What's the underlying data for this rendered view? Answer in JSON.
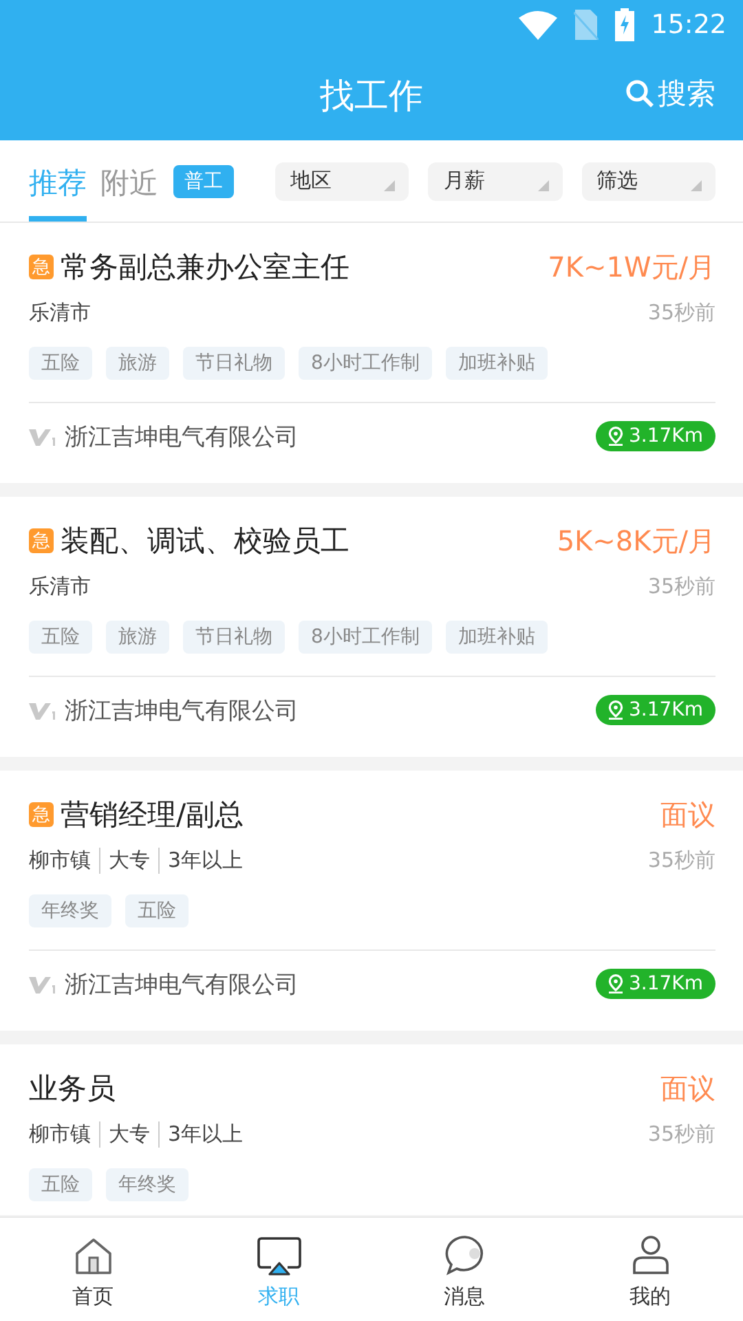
{
  "status_bar": {
    "time": "15:22"
  },
  "header": {
    "title": "找工作",
    "search_label": "搜索"
  },
  "tabs": [
    {
      "label": "推荐",
      "selected": true
    },
    {
      "label": "附近",
      "selected": false
    }
  ],
  "chip": {
    "label": "普工"
  },
  "dropdowns": [
    {
      "label": "地区"
    },
    {
      "label": "月薪"
    },
    {
      "label": "筛选"
    }
  ],
  "jobs": [
    {
      "badge": "急",
      "title": "常务副总兼办公室主任",
      "salary": "7K~1W元/月",
      "meta": [
        "乐清市"
      ],
      "time": "35秒前",
      "tags": [
        "五险",
        "旅游",
        "节日礼物",
        "8小时工作制",
        "加班补贴"
      ],
      "company": "浙江吉坤电气有限公司",
      "distance": "3.17Km"
    },
    {
      "badge": "急",
      "title": "装配、调试、校验员工",
      "salary": "5K~8K元/月",
      "meta": [
        "乐清市"
      ],
      "time": "35秒前",
      "tags": [
        "五险",
        "旅游",
        "节日礼物",
        "8小时工作制",
        "加班补贴"
      ],
      "company": "浙江吉坤电气有限公司",
      "distance": "3.17Km"
    },
    {
      "badge": "急",
      "title": "营销经理/副总",
      "salary": "面议",
      "meta": [
        "柳市镇",
        "大专",
        "3年以上"
      ],
      "time": "35秒前",
      "tags": [
        "年终奖",
        "五险"
      ],
      "company": "浙江吉坤电气有限公司",
      "distance": "3.17Km"
    },
    {
      "title": "业务员",
      "salary": "面议",
      "meta": [
        "柳市镇",
        "大专",
        "3年以上"
      ],
      "time": "35秒前",
      "tags": [
        "五险",
        "年终奖"
      ]
    }
  ],
  "nav": [
    {
      "label": "首页",
      "kind": "home",
      "selected": false
    },
    {
      "label": "求职",
      "kind": "jobs",
      "selected": true
    },
    {
      "label": "消息",
      "kind": "messages",
      "selected": false
    },
    {
      "label": "我的",
      "kind": "profile",
      "selected": false
    }
  ]
}
